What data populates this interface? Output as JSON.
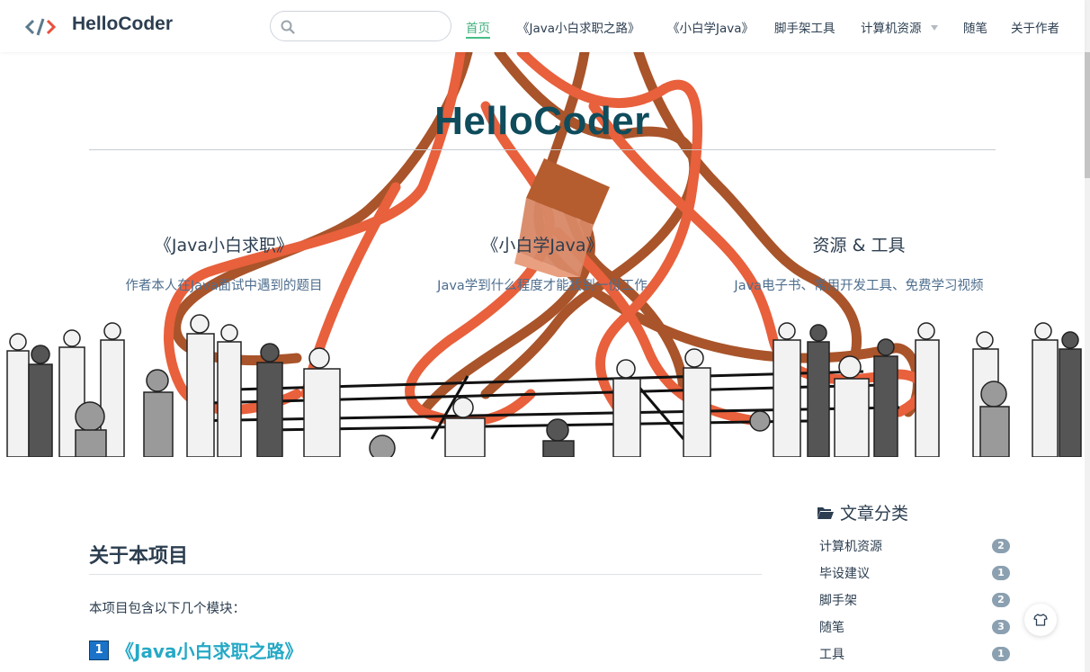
{
  "site": {
    "name": "HelloCoder"
  },
  "search": {
    "placeholder": ""
  },
  "nav": {
    "items": [
      {
        "label": "首页"
      },
      {
        "label": "《Java小白求职之路》"
      },
      {
        "label": "《小白学Java》"
      },
      {
        "label": "脚手架工具"
      },
      {
        "label": "计算机资源"
      },
      {
        "label": "随笔"
      },
      {
        "label": "关于作者"
      }
    ]
  },
  "hero": {
    "title": "HelloCoder",
    "features": [
      {
        "title": "《Java小白求职》",
        "desc": "作者本人在Java面试中遇到的题目"
      },
      {
        "title": "《小白学Java》",
        "desc": "Java学到什么程度才能找到一份工作"
      },
      {
        "title": "资源 & 工具",
        "desc": "Java电子书、常用开发工具、免费学习视频"
      }
    ]
  },
  "content": {
    "section_title": "关于本项目",
    "intro": "本项目包含以下几个模块：",
    "module_1": {
      "number": "1",
      "title": "《Java小白求职之路》"
    }
  },
  "categories": {
    "title": "文章分类",
    "items": [
      {
        "label": "计算机资源",
        "count": "2"
      },
      {
        "label": "毕设建议",
        "count": "1"
      },
      {
        "label": "脚手架",
        "count": "2"
      },
      {
        "label": "随笔",
        "count": "3"
      },
      {
        "label": "工具",
        "count": "1"
      }
    ]
  },
  "colors": {
    "accent": "#3eaf7c",
    "title": "#0f4c5c",
    "badge": "#8ba0b0",
    "route_orange": "#e8603c",
    "route_brown": "#a9542a"
  }
}
